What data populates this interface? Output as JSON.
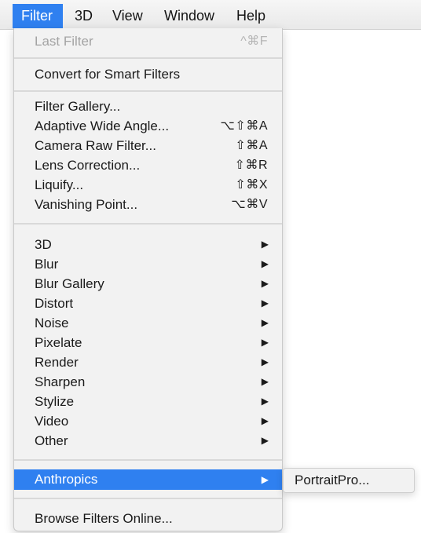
{
  "menubar": {
    "items": [
      {
        "label": "Filter"
      },
      {
        "label": "3D"
      },
      {
        "label": "View"
      },
      {
        "label": "Window"
      },
      {
        "label": "Help"
      }
    ],
    "active": "Filter"
  },
  "filter_menu": {
    "last_filter": {
      "label": "Last Filter",
      "shortcut": "^⌘F"
    },
    "convert_smart": {
      "label": "Convert for Smart Filters"
    },
    "filter_gallery": {
      "label": "Filter Gallery..."
    },
    "adaptive_wide_angle": {
      "label": "Adaptive Wide Angle...",
      "shortcut": "⌥⇧⌘A"
    },
    "camera_raw": {
      "label": "Camera Raw Filter...",
      "shortcut": "⇧⌘A"
    },
    "lens_correction": {
      "label": "Lens Correction...",
      "shortcut": "⇧⌘R"
    },
    "liquify": {
      "label": "Liquify...",
      "shortcut": "⇧⌘X"
    },
    "vanishing_point": {
      "label": "Vanishing Point...",
      "shortcut": "⌥⌘V"
    },
    "submenus": {
      "3d": "3D",
      "blur": "Blur",
      "blur_gallery": "Blur Gallery",
      "distort": "Distort",
      "noise": "Noise",
      "pixelate": "Pixelate",
      "render": "Render",
      "sharpen": "Sharpen",
      "stylize": "Stylize",
      "video": "Video",
      "other": "Other"
    },
    "anthropics": {
      "label": "Anthropics"
    },
    "browse_online": {
      "label": "Browse Filters Online..."
    },
    "arrow_glyph": "▶"
  },
  "anthropics_submenu": {
    "items": [
      {
        "label": "PortraitPro..."
      }
    ]
  },
  "colors": {
    "highlight": "#2f80f0",
    "menu_bg": "#f2f2f2",
    "disabled_text": "#a3a3a3"
  }
}
